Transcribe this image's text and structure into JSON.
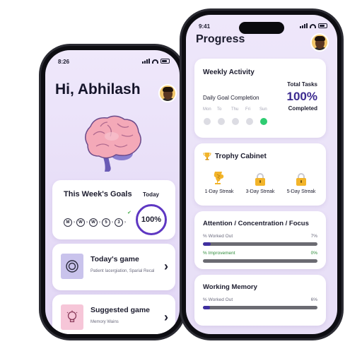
{
  "left_phone": {
    "status_time": "8:26",
    "greeting": "Hi, Abhilash",
    "weekly_goals": {
      "title": "This Week's Goals",
      "today_label": "Today",
      "days": [
        "M",
        "W",
        "W",
        "5",
        "3"
      ],
      "completion": "100%",
      "completion_fraction": 1.0
    },
    "games": [
      {
        "title": "Today's game",
        "subtitle": "Patient Iacergiation, Sparial Recal",
        "icon": "target-icon",
        "thumb_color": "#c9c3ec"
      },
      {
        "title": "Suggested game",
        "subtitle": "Memory Wains",
        "icon": "lightbulb-icon",
        "thumb_color": "#f6c6d8"
      }
    ]
  },
  "right_phone": {
    "status_time": "9:41",
    "title": "Progress",
    "weekly_activity": {
      "title": "Weekly Activity",
      "total_tasks_label": "Total Tasks",
      "daily_goal_label": "Daily Goal Completion",
      "percent": "100%",
      "completed_label": "Completed",
      "days": [
        "Mon",
        "To",
        "Thu",
        "Fri",
        "Sun"
      ],
      "active_day_index": 4
    },
    "trophy_cabinet": {
      "title": "Trophy Cabinet",
      "trophies": [
        {
          "label": "1-Day Streak",
          "icon": "trophy-icon",
          "unlocked": true
        },
        {
          "label": "3-Day Streak",
          "icon": "lock-icon",
          "unlocked": false
        },
        {
          "label": "5-Day Streak",
          "icon": "lock-icon",
          "unlocked": false
        }
      ]
    },
    "metrics": [
      {
        "title": "Attention / Concentration / Focus",
        "rows": [
          {
            "label": "% Worked Out",
            "value": "7%",
            "fraction": 0.07
          },
          {
            "label": "% Improvement",
            "value": "0%",
            "fraction": 0.0
          }
        ]
      },
      {
        "title": "Working Memory",
        "rows": [
          {
            "label": "% Worked Out",
            "value": "6%",
            "fraction": 0.06
          }
        ]
      }
    ]
  },
  "colors": {
    "accent_purple": "#5e37c2",
    "bar_fill": "#3f2fa0",
    "active_day_green": "#2ecc71",
    "improvement_green": "#2e8b3a",
    "trophy_gold": "#f2b42a"
  }
}
